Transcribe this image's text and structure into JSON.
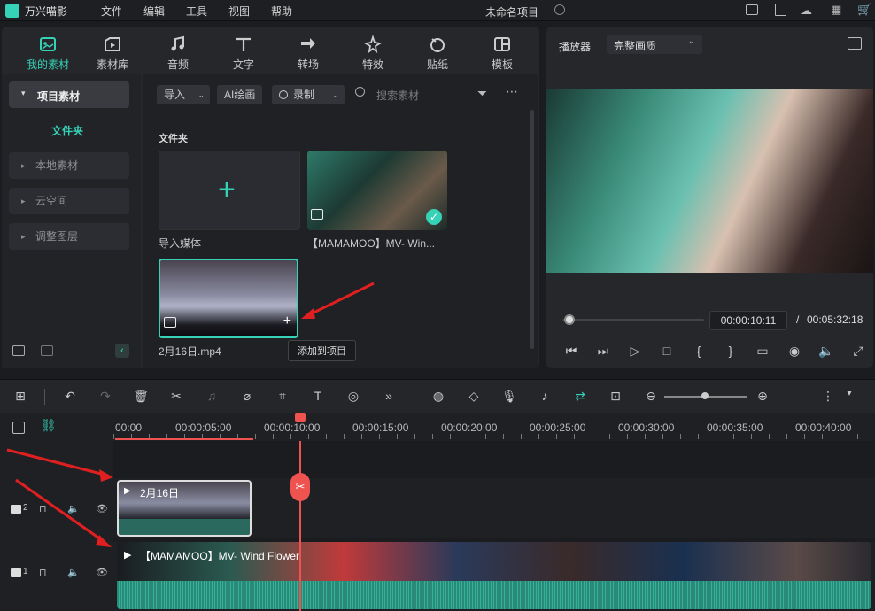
{
  "app": {
    "name": "万兴喵影",
    "project_title": "未命名项目"
  },
  "menu": [
    "文件",
    "编辑",
    "工具",
    "视图",
    "帮助"
  ],
  "tabs": [
    {
      "label": "我的素材",
      "icon": "my-media-icon",
      "active": true
    },
    {
      "label": "素材库",
      "icon": "library-icon"
    },
    {
      "label": "音频",
      "icon": "music-icon"
    },
    {
      "label": "文字",
      "icon": "text-icon"
    },
    {
      "label": "转场",
      "icon": "transition-icon"
    },
    {
      "label": "特效",
      "icon": "effects-icon"
    },
    {
      "label": "贴纸",
      "icon": "sticker-icon"
    },
    {
      "label": "模板",
      "icon": "template-icon"
    }
  ],
  "sidebar": {
    "project_media": "项目素材",
    "folder": "文件夹",
    "items": [
      "本地素材",
      "云空间",
      "调整图层"
    ]
  },
  "media_toolbar": {
    "import": "导入",
    "ai_paint": "AI绘画",
    "record": "录制",
    "search_placeholder": "搜索素材"
  },
  "media": {
    "section": "文件夹",
    "items": [
      {
        "label": "导入媒体"
      },
      {
        "label": "【MAMAMOO】MV- Win..."
      },
      {
        "label": "2月16日.mp4"
      }
    ],
    "tooltip": "添加到项目"
  },
  "preview": {
    "player_label": "播放器",
    "quality": "完整画质",
    "current_time": "00:00:10:11",
    "total_time": "00:05:32:18",
    "progress": 0.05
  },
  "timeline": {
    "ruler": [
      "00:00",
      "00:00:05:00",
      "00:00:10:00",
      "00:00:15:00",
      "00:00:20:00",
      "00:00:25:00",
      "00:00:30:00",
      "00:00:35:00",
      "00:00:40:00"
    ],
    "clip_video2": "2月16日",
    "clip_video1": "【MAMAMOO】MV- Wind Flower",
    "track2_num": "2",
    "track1_num": "1",
    "zoom": 0.4
  },
  "colors": {
    "accent": "#36d2b8",
    "playhead": "#ef5350"
  }
}
